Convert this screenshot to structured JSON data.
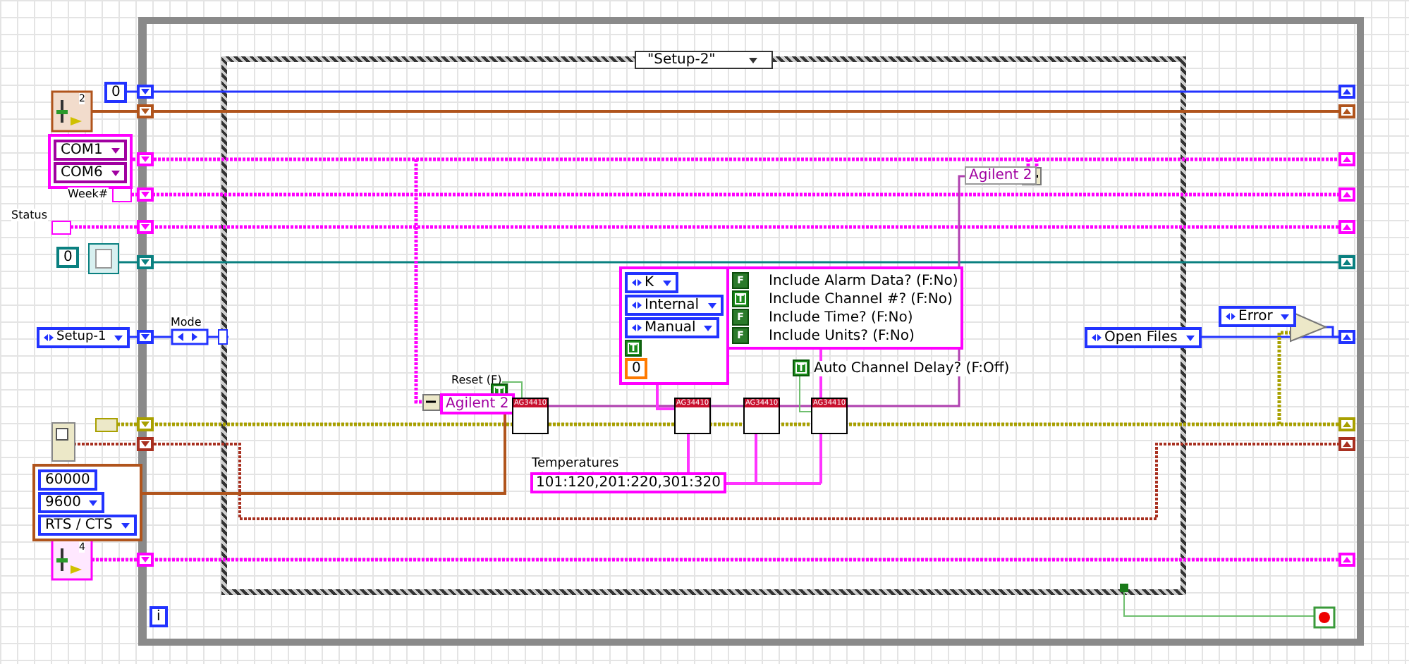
{
  "case_structure": {
    "selector": "\"Setup-2\""
  },
  "left_controls": {
    "counter": "0",
    "slider_a": "2",
    "com_ports": [
      "COM1",
      "COM6"
    ],
    "week_label": "Week#",
    "status_label": "Status",
    "file_index": "0",
    "state_enum": "Setup-1",
    "serial_cluster": {
      "timeout": "60000",
      "baud": "9600",
      "flow": "RTS / CTS"
    },
    "slider_b": "4"
  },
  "mode": {
    "label": "Mode"
  },
  "reset": {
    "label": "Reset (F)",
    "value": "T"
  },
  "instrument_name": "Agilent 2",
  "subvis": [
    {
      "header": "AG34410"
    },
    {
      "header": "AG34410"
    },
    {
      "header": "AG34410"
    },
    {
      "header": "AG34410"
    }
  ],
  "thermocouple": {
    "type": "K",
    "junction": "Internal",
    "range": "Manual",
    "flag": "T",
    "value": "0"
  },
  "format_options": [
    {
      "value": "F",
      "label": "Include Alarm Data? (F:No)"
    },
    {
      "value": "T",
      "label": "Include Channel #? (F:No)"
    },
    {
      "value": "F",
      "label": "Include Time? (F:No)"
    },
    {
      "value": "F",
      "label": "Include Units? (F:No)"
    }
  ],
  "auto_delay": {
    "value": "T",
    "label": "Auto Channel Delay? (F:Off)"
  },
  "temperatures": {
    "label": "Temperatures",
    "value": "101:120,201:220,301:320"
  },
  "output_name": "Agilent 2",
  "next_state": "Open Files",
  "error_state": "Error",
  "iteration": "i"
}
